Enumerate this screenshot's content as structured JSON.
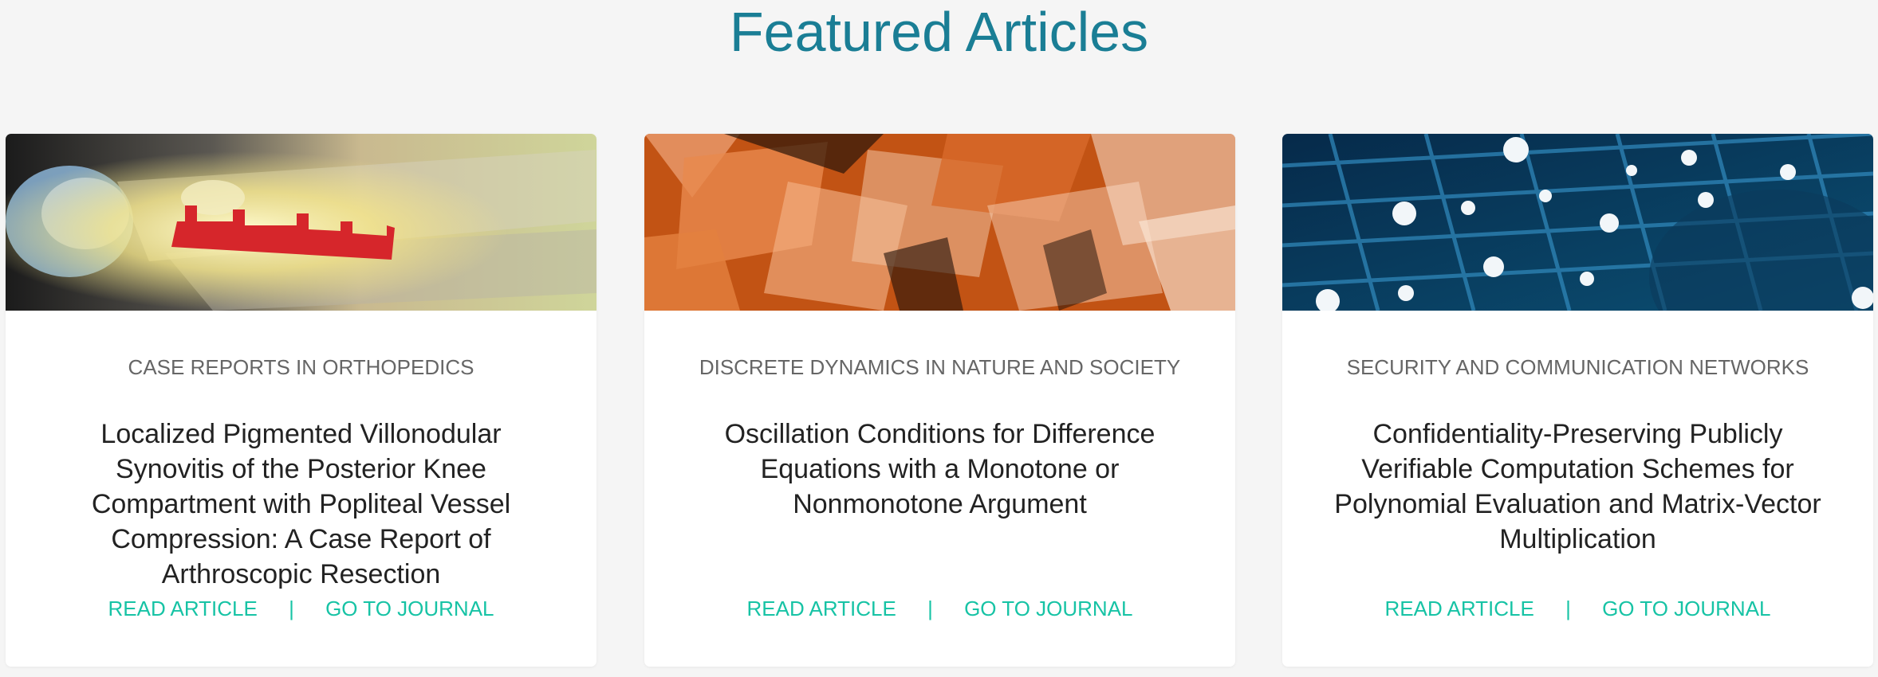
{
  "section": {
    "title": "Featured Articles"
  },
  "colors": {
    "title": "#1a7e95",
    "link": "#17c3a5",
    "journal": "#666666",
    "article_title": "#222222",
    "background": "#f5f5f5"
  },
  "cards": [
    {
      "journal": "CASE REPORTS IN ORTHOPEDICS",
      "title": "Localized Pigmented Villonodular Synovitis of the Posterior Knee Compartment with Popliteal Vessel Compression: A Case Report of Arthroscopic Resection",
      "read_label": "READ ARTICLE",
      "separator": "|",
      "journal_label": "GO TO JOURNAL"
    },
    {
      "journal": "DISCRETE DYNAMICS IN NATURE AND SOCIETY",
      "title": "Oscillation Conditions for Difference Equations with a Monotone or Nonmonotone Argument",
      "read_label": "READ ARTICLE",
      "separator": "|",
      "journal_label": "GO TO JOURNAL"
    },
    {
      "journal": "SECURITY AND COMMUNICATION NETWORKS",
      "title": "Confidentiality-Preserving Publicly Verifiable Computation Schemes for Polynomial Evaluation and Matrix-Vector Multiplication",
      "read_label": "READ ARTICLE",
      "separator": "|",
      "journal_label": "GO TO JOURNAL"
    }
  ]
}
